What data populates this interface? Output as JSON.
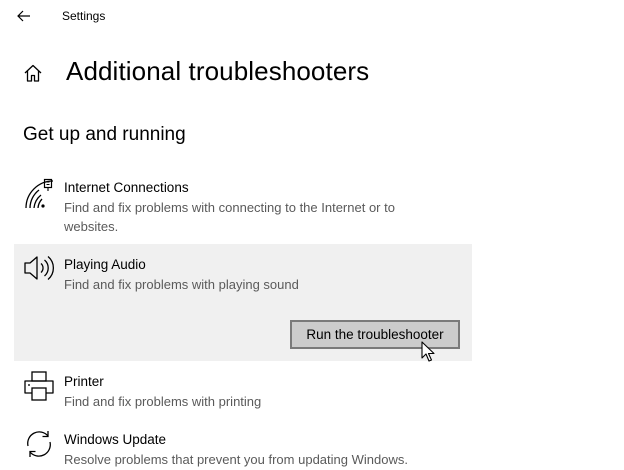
{
  "window": {
    "title": "Settings"
  },
  "page": {
    "title": "Additional troubleshooters"
  },
  "section": {
    "title": "Get up and running"
  },
  "items": [
    {
      "name": "Internet Connections",
      "description": "Find and fix problems with connecting to the Internet or to websites.",
      "icon": "wifi-signal-icon"
    },
    {
      "name": "Playing Audio",
      "description": "Find and fix problems with playing sound",
      "icon": "speaker-icon",
      "selected": true,
      "button": "Run the troubleshooter"
    },
    {
      "name": "Printer",
      "description": "Find and fix problems with printing",
      "icon": "printer-icon"
    },
    {
      "name": "Windows Update",
      "description": "Resolve problems that prevent you from updating Windows.",
      "icon": "refresh-icon"
    }
  ],
  "colors": {
    "selected_bg": "#f0f0f0",
    "button_bg": "#cccccc",
    "button_border": "#7a7a7a",
    "secondary_text": "#5a5a5a"
  }
}
